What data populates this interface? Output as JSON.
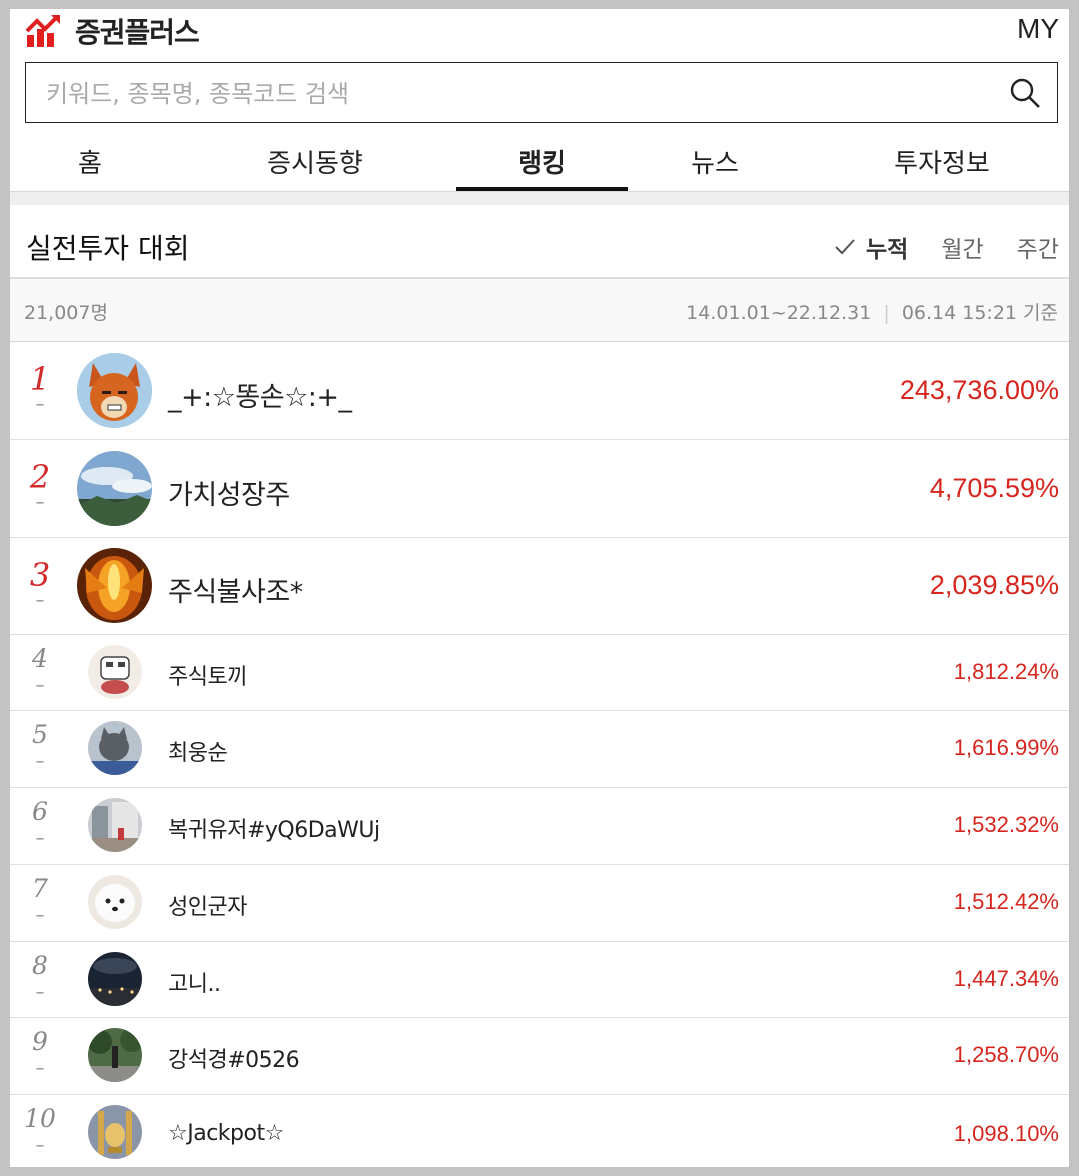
{
  "header": {
    "brand": "증권플러스",
    "my_label": "MY",
    "brand_color": "#e02020"
  },
  "search": {
    "placeholder": "키워드, 종목명, 종목코드 검색"
  },
  "tabs": [
    {
      "label": "홈",
      "active": false
    },
    {
      "label": "증시동향",
      "active": false
    },
    {
      "label": "랭킹",
      "active": true
    },
    {
      "label": "뉴스",
      "active": false
    },
    {
      "label": "투자정보",
      "active": false
    }
  ],
  "section": {
    "title": "실전투자 대회",
    "filters": [
      {
        "label": "누적",
        "selected": true
      },
      {
        "label": "월간",
        "selected": false
      },
      {
        "label": "주간",
        "selected": false
      }
    ]
  },
  "meta": {
    "participants": "21,007명",
    "period": "14.01.01~22.12.31",
    "separator": "|",
    "as_of": "06.14 15:21 기준"
  },
  "ranking": [
    {
      "rank": "1",
      "change": "–",
      "nickname": "_+:☆똥손☆:+_",
      "return": "243,736.00%",
      "avatar": "fox-character-avatar"
    },
    {
      "rank": "2",
      "change": "–",
      "nickname": "가치성장주",
      "return": "4,705.59%",
      "avatar": "sky-landscape-avatar"
    },
    {
      "rank": "3",
      "change": "–",
      "nickname": "주식불사조*",
      "return": "2,039.85%",
      "avatar": "phoenix-fire-avatar"
    },
    {
      "rank": "4",
      "change": "–",
      "nickname": "주식토끼",
      "return": "1,812.24%",
      "avatar": "rabbit-character-avatar"
    },
    {
      "rank": "5",
      "change": "–",
      "nickname": "최웅순",
      "return": "1,616.99%",
      "avatar": "cat-photo-avatar"
    },
    {
      "rank": "6",
      "change": "–",
      "nickname": "복귀유저#yQ6DaWUj",
      "return": "1,532.32%",
      "avatar": "street-photo-avatar"
    },
    {
      "rank": "7",
      "change": "–",
      "nickname": "성인군자",
      "return": "1,512.42%",
      "avatar": "white-dog-avatar"
    },
    {
      "rank": "8",
      "change": "–",
      "nickname": "고니..",
      "return": "1,447.34%",
      "avatar": "night-city-avatar"
    },
    {
      "rank": "9",
      "change": "–",
      "nickname": "강석경#0526",
      "return": "1,258.70%",
      "avatar": "park-photo-avatar"
    },
    {
      "rank": "10",
      "change": "–",
      "nickname": "☆Jackpot☆",
      "return": "1,098.10%",
      "avatar": "golden-trophy-avatar"
    }
  ]
}
